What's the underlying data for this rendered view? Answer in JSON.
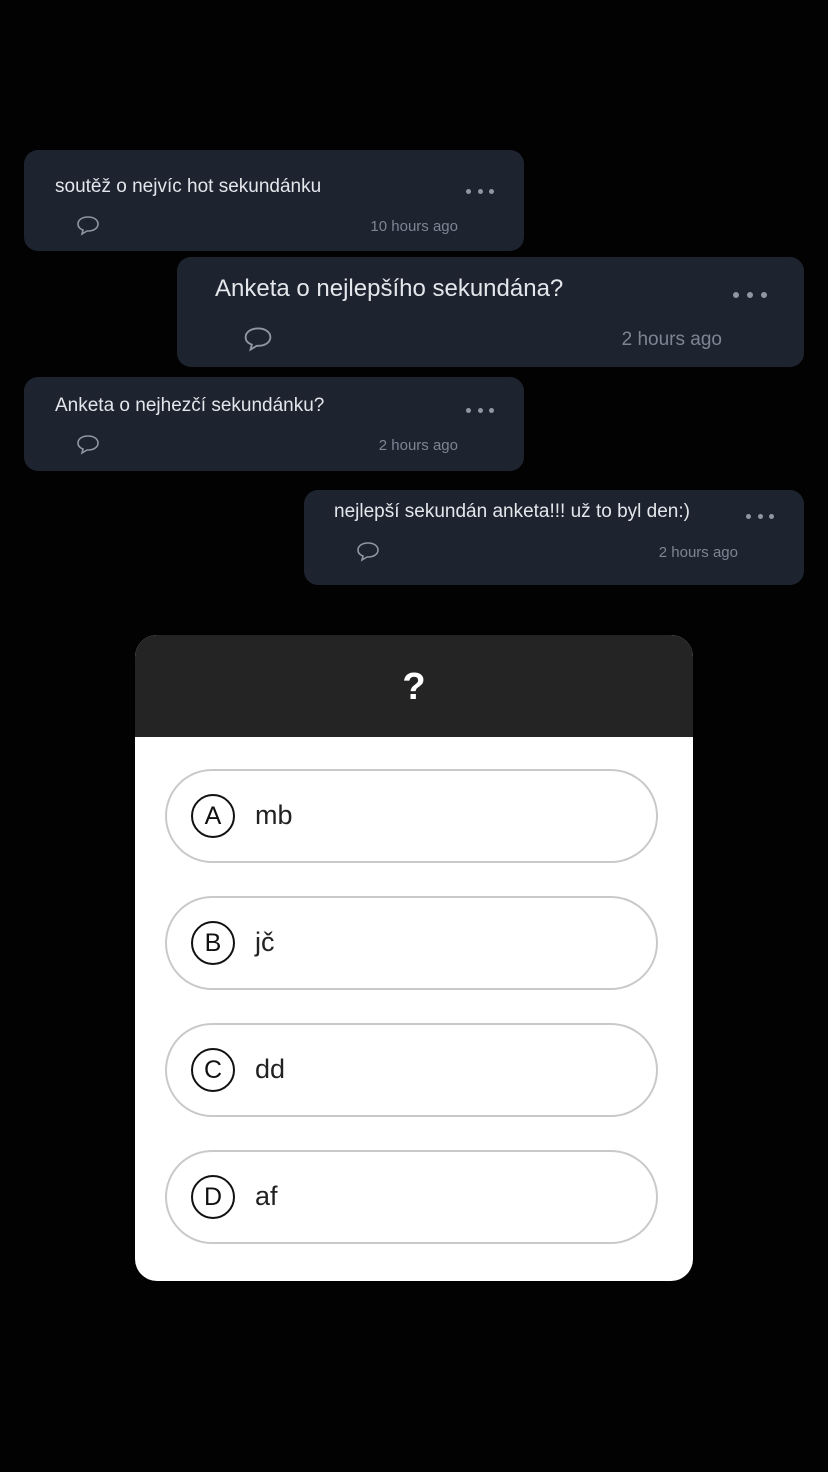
{
  "cards": [
    {
      "text": "soutěž o nejvíc hot sekundánku",
      "time": "10 hours ago"
    },
    {
      "text": "Anketa o nejlepšího sekundána?",
      "time": "2 hours ago"
    },
    {
      "text": "Anketa o nejhezčí sekundánku?",
      "time": "2 hours ago"
    },
    {
      "text": "nejlepší sekundán anketa!!! už to byl den:)",
      "time": "2 hours ago"
    }
  ],
  "quiz": {
    "question": "?",
    "options": [
      {
        "letter": "A",
        "label": "mb"
      },
      {
        "letter": "B",
        "label": "jč"
      },
      {
        "letter": "C",
        "label": "dd"
      },
      {
        "letter": "D",
        "label": "af"
      }
    ]
  },
  "icons": {
    "more": "more-dots-icon",
    "comment": "comment-bubble-icon"
  },
  "colors": {
    "background": "#020202",
    "card": "#1d2430",
    "quiz_header": "#242424",
    "quiz_body": "#ffffff"
  }
}
